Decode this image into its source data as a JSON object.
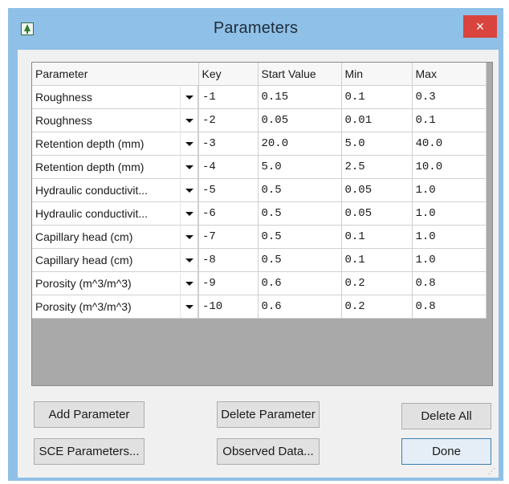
{
  "window": {
    "title": "Parameters",
    "close_label": "×",
    "icon": "tree-icon"
  },
  "table": {
    "headers": [
      "Parameter",
      "Key",
      "Start Value",
      "Min",
      "Max"
    ],
    "rows": [
      {
        "parameter": "Roughness",
        "key": "-1",
        "start": "0.15",
        "min": "0.1",
        "max": "0.3"
      },
      {
        "parameter": "Roughness",
        "key": "-2",
        "start": "0.05",
        "min": "0.01",
        "max": "0.1"
      },
      {
        "parameter": "Retention depth (mm)",
        "key": "-3",
        "start": "20.0",
        "min": "5.0",
        "max": "40.0"
      },
      {
        "parameter": "Retention depth (mm)",
        "key": "-4",
        "start": "5.0",
        "min": "2.5",
        "max": "10.0"
      },
      {
        "parameter": "Hydraulic conductivit...",
        "key": "-5",
        "start": "0.5",
        "min": "0.05",
        "max": "1.0"
      },
      {
        "parameter": "Hydraulic conductivit...",
        "key": "-6",
        "start": "0.5",
        "min": "0.05",
        "max": "1.0"
      },
      {
        "parameter": "Capillary head (cm)",
        "key": "-7",
        "start": "0.5",
        "min": "0.1",
        "max": "1.0"
      },
      {
        "parameter": "Capillary head (cm)",
        "key": "-8",
        "start": "0.5",
        "min": "0.1",
        "max": "1.0"
      },
      {
        "parameter": "Porosity (m^3/m^3)",
        "key": "-9",
        "start": "0.6",
        "min": "0.2",
        "max": "0.8"
      },
      {
        "parameter": "Porosity (m^3/m^3)",
        "key": "-10",
        "start": "0.6",
        "min": "0.2",
        "max": "0.8"
      }
    ]
  },
  "buttons": {
    "add_parameter": "Add Parameter",
    "delete_parameter": "Delete Parameter",
    "delete_all": "Delete All",
    "sce_parameters": "SCE Parameters...",
    "observed_data": "Observed Data...",
    "done": "Done"
  },
  "colors": {
    "titlebar": "#8fc0e7",
    "close": "#d9453e",
    "dialog_bg": "#f0f0f0",
    "table_empty": "#a9a9a9"
  }
}
